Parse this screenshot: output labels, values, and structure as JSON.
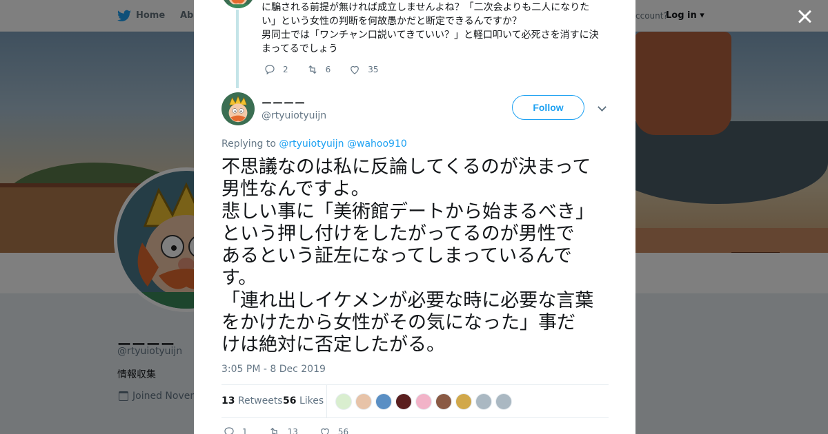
{
  "nav": {
    "home_label": "Home",
    "about_label": "Abo",
    "account_text": "ccount?",
    "login_label": "Log in ▾"
  },
  "profile": {
    "name": "ーーーー",
    "handle": "@rtyuiotyuijn",
    "bio": "情報収集",
    "joined": "Joined Novem"
  },
  "previous_tweet": {
    "lines": [
      "に騙される前提が無ければ成立しませんよね？「二次会よりも二人になりた",
      "い」という女性の判断を何故愚かだと断定できるんですか？",
      "男同士では「ワンチャン口説いてきていい？」と軽口叩いて必死さを消すに決",
      "まってるでしょう"
    ],
    "replies": "2",
    "retweets": "6",
    "likes": "35"
  },
  "tweet": {
    "author_name": "ーーーー",
    "author_handle": "@rtyuiotyuijn",
    "follow_label": "Follow",
    "replying_prefix": "Replying to ",
    "mentions": [
      "@rtyuiotyuijn",
      "@wahoo910"
    ],
    "text_lines": [
      "不思議なのは私に反論してくるのが決まって",
      "男性なんですよ。",
      "悲しい事に「美術館デートから始まるべき」",
      "という押し付けをしたがってるのが男性で",
      "あるという証左になってしまっているんで",
      "す。",
      "「連れ出しイケメンが必要な時に必要な言葉",
      "をかけたから女性がその気になった」事だ",
      "けは絶対に否定したがる。"
    ],
    "timestamp": "3:05 PM - 8 Dec 2019",
    "retweet_count": "13",
    "retweet_label": "Retweets",
    "like_count": "56",
    "like_label": "Likes",
    "replies": "1",
    "retweets": "13",
    "likes": "56",
    "liker_colors": [
      "#d9eecf",
      "#e7c3a8",
      "#5a8fc4",
      "#5a1f1f",
      "#f2b3c8",
      "#8a5a44",
      "#d1a84a",
      "#aab8c2",
      "#aab8c2"
    ]
  },
  "colors": {
    "accent": "#1da1f2",
    "thread_line": "#c4e4e8"
  }
}
